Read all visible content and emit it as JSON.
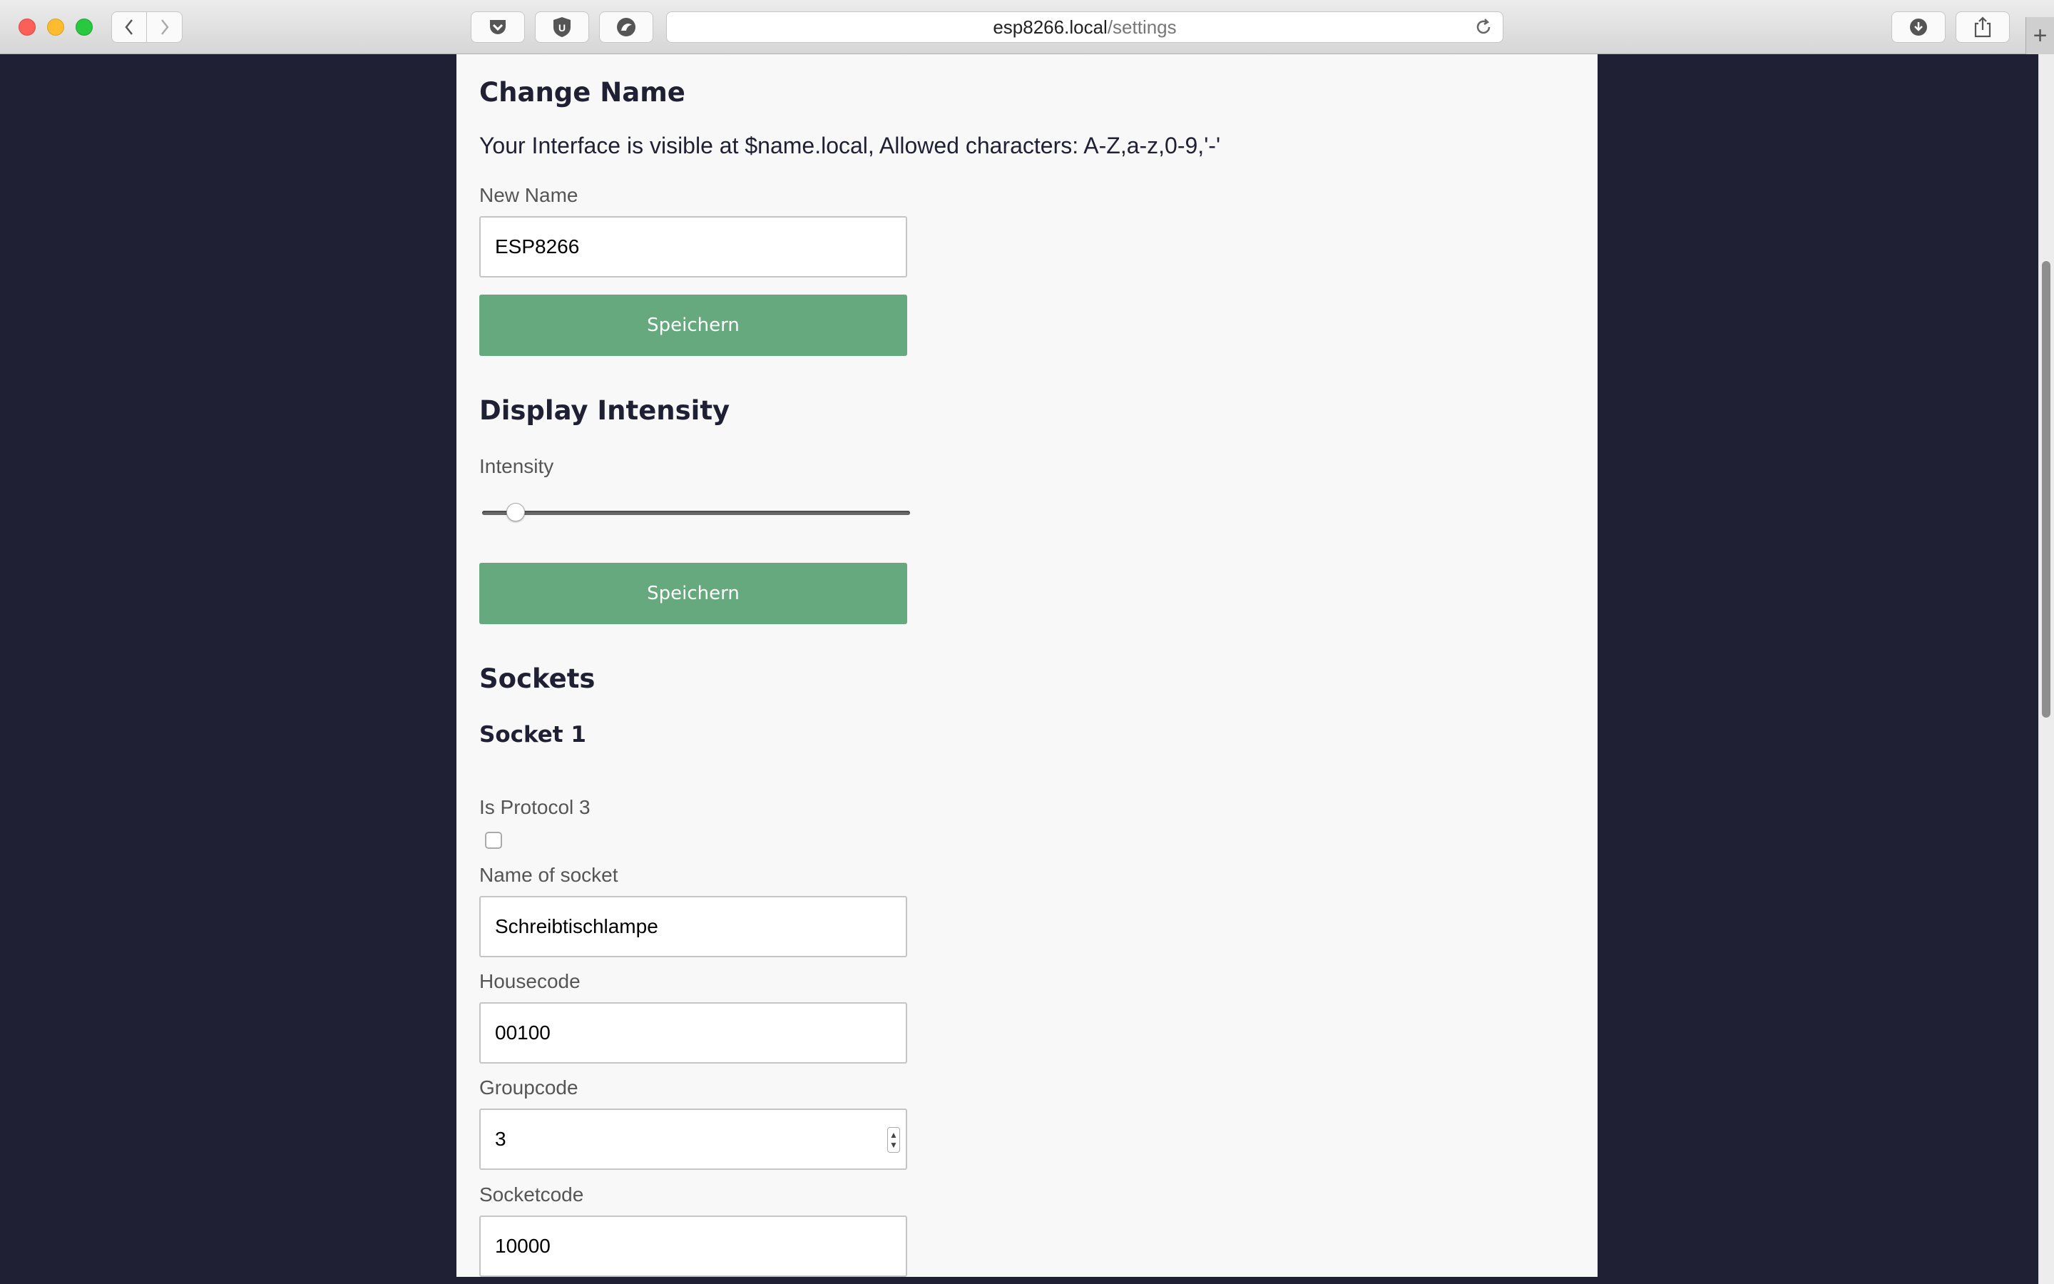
{
  "browser": {
    "url_host": "esp8266.local",
    "url_path": "/settings",
    "icons": [
      "pocket-icon",
      "ublock-icon",
      "extension-icon",
      "download-icon",
      "share-icon",
      "reload-icon"
    ]
  },
  "change_name": {
    "heading": "Change Name",
    "description": "Your Interface is visible at $name.local, Allowed characters: A-Z,a-z,0-9,'-'",
    "label": "New Name",
    "value": "ESP8266",
    "button": "Speichern"
  },
  "display_intensity": {
    "heading": "Display Intensity",
    "label": "Intensity",
    "slider_fraction": 0.06,
    "button": "Speichern"
  },
  "sockets": {
    "heading": "Sockets",
    "socket": {
      "heading": "Socket 1",
      "protocol_label": "Is Protocol 3",
      "protocol_checked": false,
      "name_label": "Name of socket",
      "name_value": "Schreibtischlampe",
      "housecode_label": "Housecode",
      "housecode_value": "00100",
      "groupcode_label": "Groupcode",
      "groupcode_value": "3",
      "socketcode_label": "Socketcode",
      "socketcode_value": "10000"
    }
  },
  "colors": {
    "button": "#66a97e",
    "page_background": "#1f2033",
    "heading": "#1f2033"
  }
}
